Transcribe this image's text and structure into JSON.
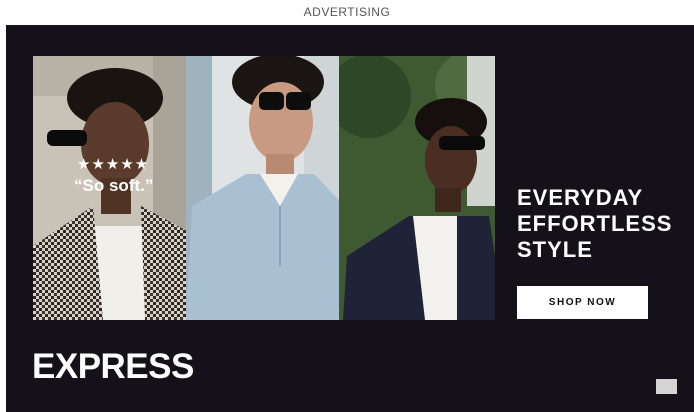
{
  "ad_label": "ADVERTISING",
  "review": {
    "stars": "★★★★★",
    "quote": "“So soft.”"
  },
  "headline": {
    "line1": "EVERYDAY",
    "line2": "EFFORTLESS",
    "line3": "STYLE"
  },
  "cta": {
    "label": "SHOP NOW"
  },
  "brand": {
    "logo_text": "EXPRESS"
  },
  "icons": {
    "adchoices": "adchoices-icon"
  },
  "colors": {
    "ad_background": "#141218",
    "text": "#ffffff",
    "button_background": "#ffffff",
    "button_text": "#111111"
  }
}
